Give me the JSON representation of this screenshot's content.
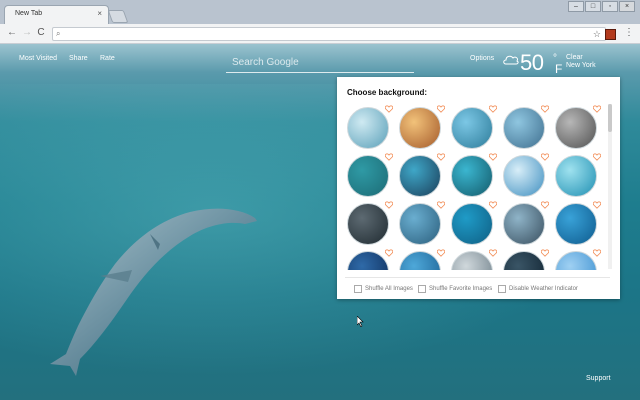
{
  "browser": {
    "tab_title": "New Tab",
    "tab_close": "×",
    "window_controls": [
      "minimize",
      "restore",
      "close"
    ]
  },
  "toolbar": {
    "back": "←",
    "forward": "→",
    "reload": "C",
    "address_value": "",
    "menu": "⋮"
  },
  "header": {
    "links": [
      "Most Visited",
      "Share",
      "Rate"
    ],
    "search_placeholder": "Search Google",
    "options": "Options"
  },
  "weather": {
    "temperature": "50",
    "degree": "°",
    "unit": "F",
    "condition": "Clear",
    "location": "New York",
    "icon": "cloud-icon"
  },
  "panel": {
    "title": "Choose background:",
    "thumbnails": [
      {
        "colors": [
          "#cfeaf2",
          "#5a9fb8"
        ]
      },
      {
        "colors": [
          "#f2c27a",
          "#a45a2a"
        ]
      },
      {
        "colors": [
          "#7cc7e5",
          "#2d7c9a"
        ]
      },
      {
        "colors": [
          "#8fc6e0",
          "#3f6f8f"
        ]
      },
      {
        "colors": [
          "#b7b7b7",
          "#505050"
        ]
      },
      {
        "colors": [
          "#2f9aa5",
          "#1c6b75"
        ]
      },
      {
        "colors": [
          "#3fa7c8",
          "#1b3f5a"
        ]
      },
      {
        "colors": [
          "#3bb6d0",
          "#135a6a"
        ]
      },
      {
        "colors": [
          "#d8eef8",
          "#3f8fc0"
        ]
      },
      {
        "colors": [
          "#9fe2ef",
          "#1f8fb2"
        ]
      },
      {
        "colors": [
          "#5d6a72",
          "#1f2a30"
        ]
      },
      {
        "colors": [
          "#6aaed0",
          "#2b5f7d"
        ]
      },
      {
        "colors": [
          "#1f9bc7",
          "#0f5f84"
        ]
      },
      {
        "colors": [
          "#8fb4c8",
          "#394f5f"
        ]
      },
      {
        "colors": [
          "#39a2d8",
          "#0e5b8e"
        ]
      },
      {
        "colors": [
          "#2f6aa8",
          "#0d2d5a"
        ]
      },
      {
        "colors": [
          "#4ea8d9",
          "#1a5f92"
        ]
      },
      {
        "colors": [
          "#d0d8dc",
          "#6d7e88"
        ]
      },
      {
        "colors": [
          "#3a5566",
          "#0f2230"
        ]
      },
      {
        "colors": [
          "#9fd0f2",
          "#3a8fd0"
        ]
      }
    ],
    "options": [
      "Shuffle All Images",
      "Shuffle Favorite Images",
      "Disable Weather Indicator"
    ]
  },
  "footer": {
    "support": "Support"
  },
  "colors": {
    "heart": "#f28c55",
    "panel_bg": "#ffffff"
  }
}
